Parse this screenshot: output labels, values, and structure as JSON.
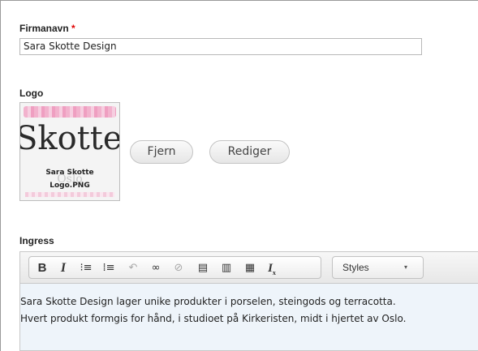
{
  "company": {
    "label": "Firmanavn",
    "required_mark": "*",
    "value": "Sara Skotte Design"
  },
  "logo": {
    "label": "Logo",
    "image_text": "Skotte D",
    "ghost_text": "Oslo",
    "file_name_line1": "Sara Skotte",
    "file_name_line2": "Logo.PNG",
    "remove_label": "Fjern",
    "edit_label": "Rediger"
  },
  "ingress": {
    "label": "Ingress",
    "toolbar": {
      "buttons": [
        {
          "icon": "bold-icon",
          "glyph": "B"
        },
        {
          "icon": "italic-icon",
          "glyph": "I"
        },
        {
          "icon": "bulleted-list-icon",
          "glyph": "⁝≡"
        },
        {
          "icon": "numbered-list-icon",
          "glyph": "⁞≡"
        },
        {
          "icon": "undo-icon",
          "glyph": "↶"
        },
        {
          "icon": "link-icon",
          "glyph": "∞"
        },
        {
          "icon": "unlink-icon",
          "glyph": "⊘"
        },
        {
          "icon": "paste-icon",
          "glyph": "▤"
        },
        {
          "icon": "paste-text-icon",
          "glyph": "▥"
        },
        {
          "icon": "paste-word-icon",
          "glyph": "▦"
        },
        {
          "icon": "remove-format-icon",
          "glyph": "I"
        }
      ],
      "styles_label": "Styles",
      "styles_arrow": "▾"
    },
    "content": [
      "Sara Skotte Design lager unike produkter i porselen, steingods og terracotta.",
      "Hvert produkt formgis for hånd, i studioet på Kirkeristen, midt i hjertet av Oslo."
    ]
  },
  "colors": {
    "required": "#e00000",
    "editor_background": "#eef4fa",
    "logo_pink": "#f2a6c6"
  }
}
